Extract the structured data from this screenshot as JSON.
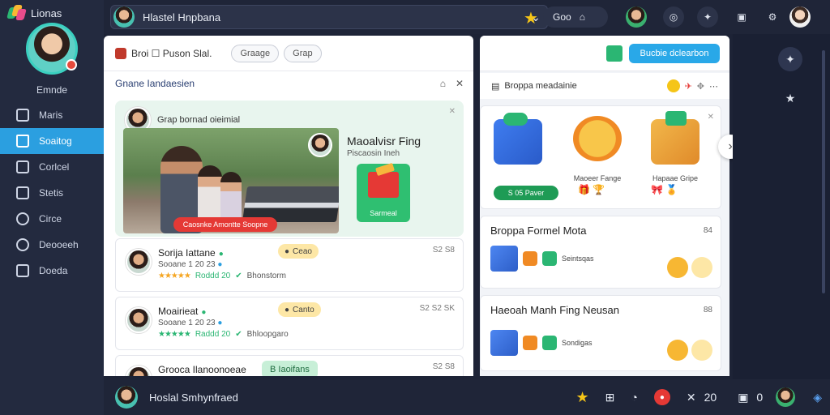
{
  "sidebar": {
    "brand_name": "Lionas",
    "profile_name": "Emnde",
    "items": [
      {
        "label": "Maris",
        "icon": "chart-icon"
      },
      {
        "label": "Soaitog",
        "icon": "home-icon",
        "active": true
      },
      {
        "label": "Corlcel",
        "icon": "window-icon"
      },
      {
        "label": "Stetis",
        "icon": "calendar-icon"
      },
      {
        "label": "Circe",
        "icon": "globe-icon"
      },
      {
        "label": "Deooeeh",
        "icon": "settings-icon"
      },
      {
        "label": "Doeda",
        "icon": "list-icon"
      }
    ]
  },
  "topbar": {
    "search_text": "Hlastel Hnpbana",
    "pill_text": "Goo",
    "pill_icon": "cart-icon"
  },
  "left_panel": {
    "title": "Broi ☐ Puson Slal.",
    "chips": [
      "Graage",
      "Grap"
    ],
    "subtitle": "Gnane Iandaesien",
    "featured": {
      "header": "Grap bornad oieimial",
      "overlay_label": "Caosnke Amontte Soopne",
      "right_title": "Maoalvisr Fing",
      "right_sub": "Piscaosin Ineh",
      "gift_label": "Sarmeal"
    },
    "posts": [
      {
        "name": "Sorija Iattane",
        "sub": "Sooane 1 20 23",
        "rating_text": "Roddd 20",
        "extra": "Bhonstorm",
        "chip": "Ceao",
        "time": "S2 S8"
      },
      {
        "name": "Moairieat",
        "sub": "Sooane 1 20 23",
        "rating_text": "Raddd 20",
        "extra": "Bhloopgaro",
        "chip": "Canto",
        "time": "S2 S2 SK"
      },
      {
        "name": "Grooca Ilanoonoeae",
        "green_chip": "B Iaoifans",
        "time": "S2 S8"
      }
    ]
  },
  "right_panel": {
    "top_button": "Bucbie dclearbon",
    "bar_title": "Broppa meadainie",
    "gifts": [
      {
        "label": "Maoeer Fange"
      },
      {
        "label": "Hapaae Gripe"
      }
    ],
    "gift_pill": "S 05 Paver",
    "sections": [
      {
        "title": "Broppa Formel Mota",
        "meta": "84",
        "icons_label": "Seintsqas"
      },
      {
        "title": "Haeoah Manh Fing Neusan",
        "meta": "88",
        "icons_label": "Sondigas"
      }
    ]
  },
  "bottombar": {
    "name": "Hoslal Smhynfraed",
    "count": "20",
    "count2": "0"
  },
  "colors": {
    "accent": "#2b9fe0",
    "sidebar_bg": "#232a3f",
    "green": "#2bb673",
    "star": "#f5c518",
    "red": "#e53935"
  }
}
